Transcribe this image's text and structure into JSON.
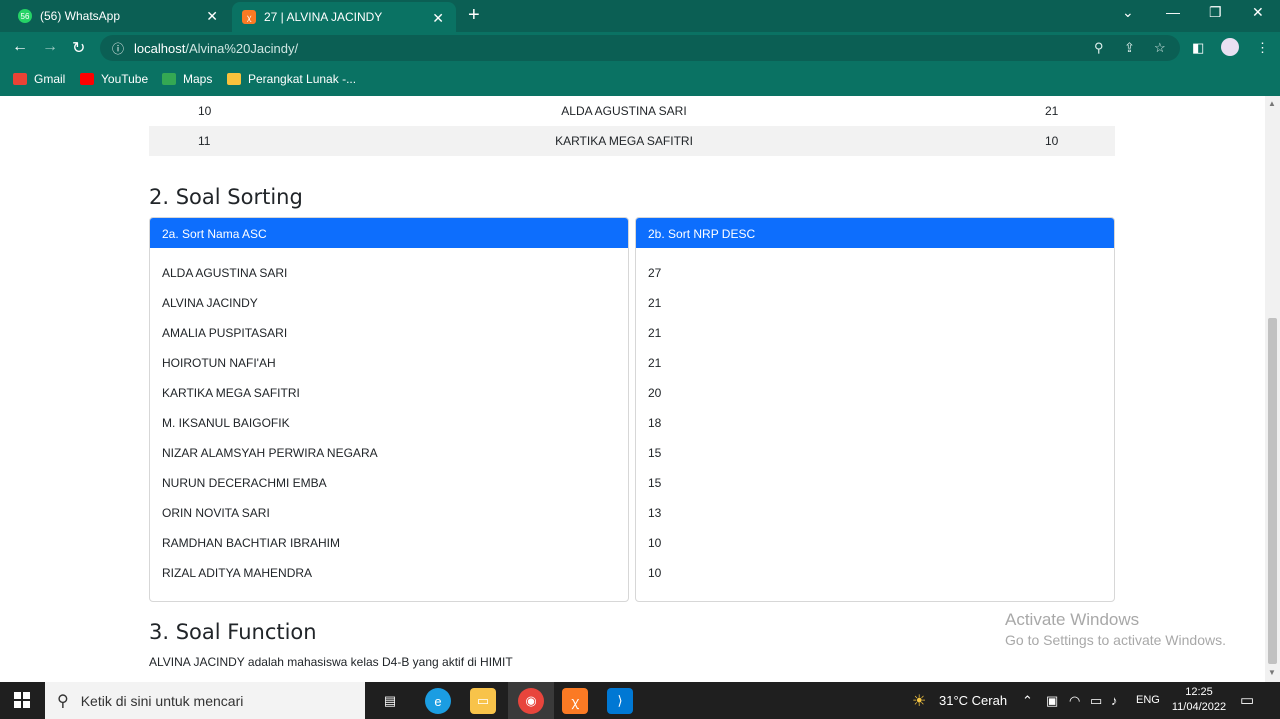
{
  "browser": {
    "tabs": [
      {
        "title": "(56) WhatsApp",
        "icon": "whatsapp-icon"
      },
      {
        "title": "27 | ALVINA JACINDY",
        "icon": "xampp-icon"
      }
    ],
    "address": {
      "host": "localhost",
      "path": "/Alvina%20Jacindy/"
    },
    "bookmarks": [
      {
        "label": "Gmail",
        "icon": "gmail-icon"
      },
      {
        "label": "YouTube",
        "icon": "youtube-icon"
      },
      {
        "label": "Maps",
        "icon": "maps-icon"
      },
      {
        "label": "Perangkat Lunak -...",
        "icon": "folder-icon"
      }
    ]
  },
  "top_table": {
    "rows": [
      {
        "no": "10",
        "name": "ALDA AGUSTINA SARI",
        "nrp": "21"
      },
      {
        "no": "11",
        "name": "KARTIKA MEGA SAFITRI",
        "nrp": "10"
      }
    ]
  },
  "sorting": {
    "heading": "2. Soal Sorting",
    "asc": {
      "title": "2a. Sort Nama ASC",
      "items": [
        "ALDA AGUSTINA SARI",
        "ALVINA JACINDY",
        "AMALIA PUSPITASARI",
        "HOIROTUN NAFI'AH",
        "KARTIKA MEGA SAFITRI",
        "M. IKSANUL BAIGOFIK",
        "NIZAR ALAMSYAH PERWIRA NEGARA",
        "NURUN DECERACHMI EMBA",
        "ORIN NOVITA SARI",
        "RAMDHAN BACHTIAR IBRAHIM",
        "RIZAL ADITYA MAHENDRA"
      ]
    },
    "desc": {
      "title": "2b. Sort NRP DESC",
      "items": [
        "27",
        "21",
        "21",
        "21",
        "20",
        "18",
        "15",
        "15",
        "13",
        "10",
        "10"
      ]
    }
  },
  "function_section": {
    "heading": "3. Soal Function",
    "text": "ALVINA JACINDY adalah mahasiswa kelas D4-B yang aktif di HIMIT"
  },
  "watermark": {
    "line1": "Activate Windows",
    "line2": "Go to Settings to activate Windows."
  },
  "taskbar": {
    "search_placeholder": "Ketik di sini untuk mencari",
    "weather": "31°C  Cerah",
    "lang": "ENG",
    "time": "12:25",
    "date": "11/04/2022"
  },
  "colors": {
    "accent": "#0d6efd",
    "chrome": "#0a7263"
  }
}
